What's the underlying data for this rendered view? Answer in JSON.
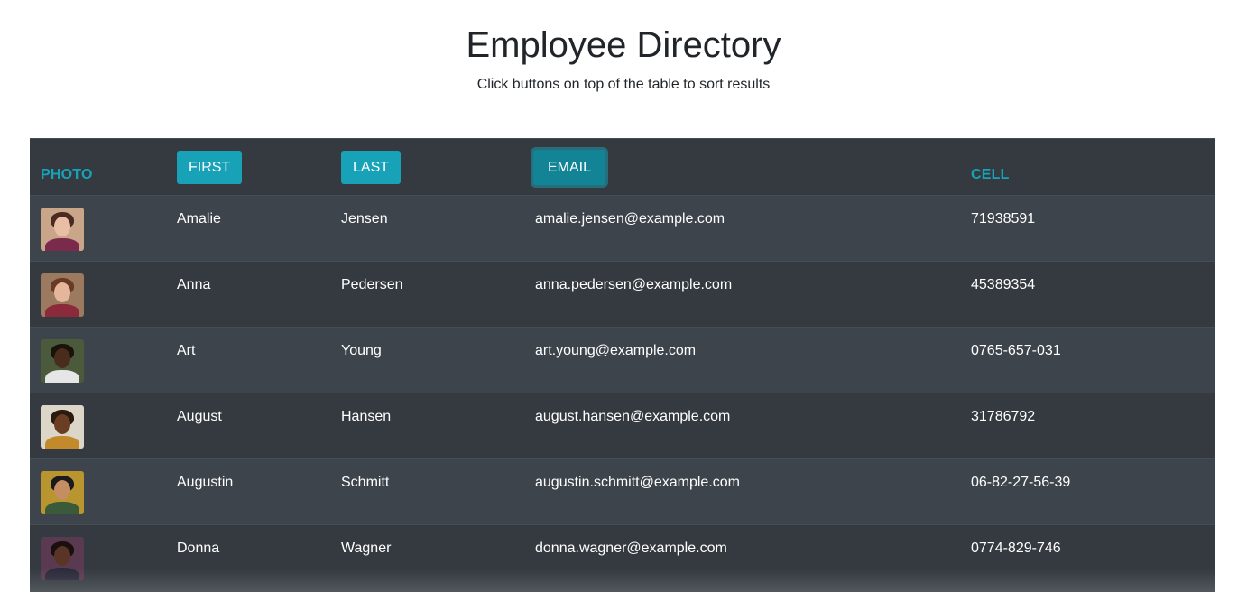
{
  "page": {
    "title": "Employee Directory",
    "subtitle": "Click buttons on top of the table to sort results"
  },
  "table": {
    "headers": {
      "photo": "PHOTO",
      "first": "FIRST",
      "last": "LAST",
      "email": "EMAIL",
      "cell": "CELL"
    },
    "active_sort": "email",
    "rows": [
      {
        "first": "Amalie",
        "last": "Jensen",
        "email": "amalie.jensen@example.com",
        "cell": "71938591",
        "photo_bg": "#c9a58a",
        "photo_hair": "#4a2a22",
        "photo_skin": "#e8bfa5",
        "photo_shirt": "#7a2a4a"
      },
      {
        "first": "Anna",
        "last": "Pedersen",
        "email": "anna.pedersen@example.com",
        "cell": "45389354",
        "photo_bg": "#9c7a60",
        "photo_hair": "#6a3a25",
        "photo_skin": "#e4b79a",
        "photo_shirt": "#8a2a3a"
      },
      {
        "first": "Art",
        "last": "Young",
        "email": "art.young@example.com",
        "cell": "0765-657-031",
        "photo_bg": "#4a5a3a",
        "photo_hair": "#1c120c",
        "photo_skin": "#4a2c1c",
        "photo_shirt": "#e6e6e6"
      },
      {
        "first": "August",
        "last": "Hansen",
        "email": "august.hansen@example.com",
        "cell": "31786792",
        "photo_bg": "#dcd6c8",
        "photo_hair": "#2a1a10",
        "photo_skin": "#6a3e22",
        "photo_shirt": "#c28a2a"
      },
      {
        "first": "Augustin",
        "last": "Schmitt",
        "email": "augustin.schmitt@example.com",
        "cell": "06-82-27-56-39",
        "photo_bg": "#b9952f",
        "photo_hair": "#1a1a1a",
        "photo_skin": "#c48e62",
        "photo_shirt": "#3a5a3a"
      },
      {
        "first": "Donna",
        "last": "Wagner",
        "email": "donna.wagner@example.com",
        "cell": "0774-829-746",
        "photo_bg": "#5a3a50",
        "photo_hair": "#1a0e0e",
        "photo_skin": "#5a3424",
        "photo_shirt": "#2a2a3a"
      }
    ]
  },
  "colors": {
    "accent": "#17a2b8",
    "table_bg": "#343a40",
    "table_row_alt": "#3e444b"
  }
}
